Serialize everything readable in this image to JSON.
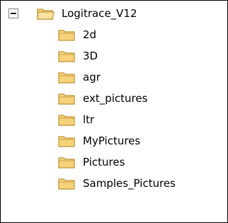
{
  "tree": {
    "root": {
      "label": "Logitrace_V12",
      "expanded": true,
      "expander_icon": "minus-box-icon",
      "icon": "folder-open-icon"
    },
    "children": [
      {
        "label": "2d",
        "icon": "folder-icon"
      },
      {
        "label": "3D",
        "icon": "folder-icon"
      },
      {
        "label": "agr",
        "icon": "folder-icon"
      },
      {
        "label": "ext_pictures",
        "icon": "folder-icon"
      },
      {
        "label": "ltr",
        "icon": "folder-icon"
      },
      {
        "label": "MyPictures",
        "icon": "folder-icon"
      },
      {
        "label": "Pictures",
        "icon": "folder-icon"
      },
      {
        "label": "Samples_Pictures",
        "icon": "folder-icon"
      }
    ]
  },
  "colors": {
    "folder_fill": "#f6d27a",
    "folder_outline": "#c8a14b",
    "border": "#000000",
    "expander_border": "#808080"
  }
}
